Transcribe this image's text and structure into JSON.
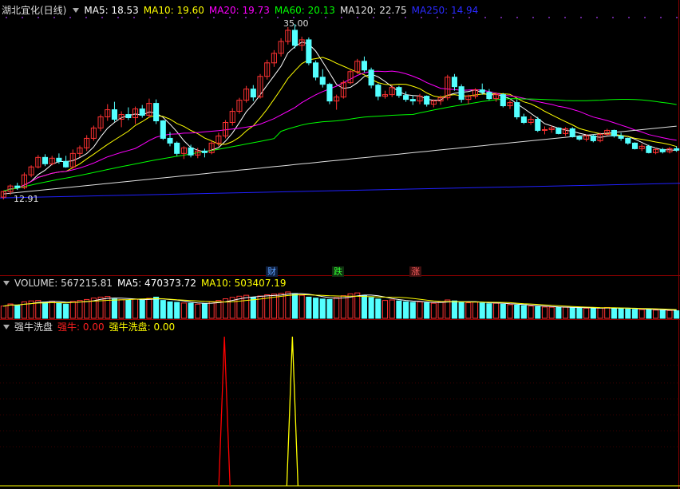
{
  "price_header": {
    "stock": "湖北宜化(日线)",
    "ma5": "MA5: 18.53",
    "ma10": "MA10: 19.60",
    "ma20": "MA20: 19.73",
    "ma60": "MA60: 20.13",
    "ma120": "MA120: 22.75",
    "ma250": "MA250: 14.94"
  },
  "volume_header": {
    "volume": "VOLUME: 567215.81",
    "ma5": "MA5: 470373.72",
    "ma10": "MA10: 503407.19"
  },
  "indicator_header": {
    "name": "强牛洗盘",
    "line1": "强牛: 0.00",
    "line2": "强牛洗盘: 0.00"
  },
  "markers": {
    "high_label": "35.00",
    "low_label": "12.91",
    "event_cai": "财",
    "event_die": "跌",
    "event_zhang": "涨"
  },
  "colors": {
    "up": "#ff3232",
    "down": "#54ffff",
    "ma5": "#ffffff",
    "ma10": "#ffff00",
    "ma20": "#ff00ff",
    "ma60": "#00ff00",
    "ma120": "#e0e0e0",
    "ma250": "#2020ff",
    "indicator1": "#ff0000",
    "indicator2": "#ffff00"
  },
  "chart_data": {
    "type": "candlestick",
    "price_range": [
      12.91,
      35.0
    ],
    "candles": [
      [
        13.2,
        14.0,
        12.91,
        13.9
      ],
      [
        13.9,
        14.8,
        13.5,
        14.6
      ],
      [
        14.6,
        15.0,
        14.1,
        14.4
      ],
      [
        14.4,
        16.3,
        14.2,
        16.0
      ],
      [
        16.0,
        17.2,
        15.7,
        17.0
      ],
      [
        17.0,
        18.5,
        16.8,
        18.2
      ],
      [
        18.2,
        18.6,
        17.1,
        17.4
      ],
      [
        17.4,
        18.4,
        17.2,
        18.1
      ],
      [
        18.1,
        18.7,
        17.4,
        17.7
      ],
      [
        17.7,
        18.4,
        16.9,
        17.0
      ],
      [
        17.0,
        19.2,
        16.8,
        18.7
      ],
      [
        18.7,
        19.7,
        18.2,
        19.4
      ],
      [
        19.4,
        21.0,
        19.0,
        20.6
      ],
      [
        20.6,
        22.2,
        20.3,
        21.9
      ],
      [
        21.9,
        23.6,
        21.5,
        23.3
      ],
      [
        23.3,
        24.9,
        22.8,
        24.2
      ],
      [
        24.2,
        25.2,
        22.7,
        23.0
      ],
      [
        23.0,
        24.0,
        22.0,
        23.6
      ],
      [
        23.6,
        24.5,
        22.9,
        23.2
      ],
      [
        23.2,
        24.6,
        22.4,
        24.3
      ],
      [
        24.3,
        24.8,
        23.2,
        23.5
      ],
      [
        23.5,
        25.6,
        23.2,
        25.0
      ],
      [
        25.0,
        25.5,
        22.4,
        22.8
      ],
      [
        22.8,
        22.9,
        20.4,
        20.6
      ],
      [
        20.6,
        21.4,
        19.6,
        20.0
      ],
      [
        20.0,
        20.2,
        18.4,
        18.7
      ],
      [
        18.7,
        19.6,
        18.0,
        19.4
      ],
      [
        19.4,
        19.8,
        18.2,
        18.5
      ],
      [
        18.5,
        19.4,
        18.1,
        19.0
      ],
      [
        19.0,
        19.3,
        18.2,
        18.8
      ],
      [
        18.8,
        20.3,
        18.6,
        20.0
      ],
      [
        20.0,
        21.3,
        19.6,
        20.9
      ],
      [
        20.9,
        22.9,
        20.6,
        22.6
      ],
      [
        22.6,
        24.4,
        22.2,
        24.0
      ],
      [
        24.0,
        25.7,
        23.7,
        25.4
      ],
      [
        25.4,
        27.2,
        25.1,
        26.8
      ],
      [
        26.8,
        27.3,
        25.3,
        25.8
      ],
      [
        25.8,
        28.7,
        25.6,
        28.4
      ],
      [
        28.4,
        30.5,
        28.0,
        30.1
      ],
      [
        30.1,
        31.7,
        29.6,
        31.3
      ],
      [
        31.3,
        33.2,
        30.9,
        32.8
      ],
      [
        32.8,
        34.6,
        32.4,
        34.2
      ],
      [
        34.2,
        35.0,
        31.9,
        32.3
      ],
      [
        32.3,
        33.4,
        31.6,
        33.0
      ],
      [
        33.0,
        33.3,
        29.8,
        30.1
      ],
      [
        30.1,
        30.4,
        27.9,
        28.3
      ],
      [
        28.3,
        29.3,
        27.0,
        27.4
      ],
      [
        27.4,
        27.6,
        24.9,
        25.3
      ],
      [
        25.3,
        26.1,
        24.2,
        25.8
      ],
      [
        25.8,
        27.9,
        25.6,
        27.6
      ],
      [
        27.6,
        29.3,
        27.4,
        29.0
      ],
      [
        29.0,
        30.6,
        28.7,
        30.3
      ],
      [
        30.3,
        30.9,
        28.9,
        29.2
      ],
      [
        29.2,
        29.5,
        26.9,
        27.3
      ],
      [
        27.3,
        27.5,
        25.4,
        25.9
      ],
      [
        25.9,
        26.6,
        25.6,
        26.1
      ],
      [
        26.1,
        27.3,
        25.8,
        27.0
      ],
      [
        27.0,
        27.2,
        25.7,
        26.0
      ],
      [
        26.0,
        26.5,
        25.2,
        25.5
      ],
      [
        25.5,
        26.0,
        24.8,
        25.3
      ],
      [
        25.3,
        26.2,
        24.9,
        25.9
      ],
      [
        25.9,
        26.0,
        24.6,
        24.9
      ],
      [
        24.9,
        25.5,
        24.5,
        25.3
      ],
      [
        25.3,
        26.0,
        24.8,
        25.7
      ],
      [
        25.7,
        28.6,
        25.4,
        28.3
      ],
      [
        28.3,
        28.7,
        26.6,
        27.1
      ],
      [
        27.1,
        27.4,
        25.1,
        25.5
      ],
      [
        25.5,
        26.1,
        24.9,
        25.9
      ],
      [
        25.9,
        26.9,
        25.6,
        26.7
      ],
      [
        26.7,
        27.5,
        26.1,
        26.4
      ],
      [
        26.4,
        26.8,
        25.4,
        25.6
      ],
      [
        25.6,
        26.4,
        25.2,
        26.1
      ],
      [
        26.1,
        26.3,
        24.5,
        24.7
      ],
      [
        24.7,
        25.4,
        24.3,
        25.1
      ],
      [
        25.1,
        25.5,
        23.0,
        23.3
      ],
      [
        23.3,
        23.7,
        22.4,
        22.6
      ],
      [
        22.6,
        23.4,
        22.3,
        23.0
      ],
      [
        23.0,
        23.3,
        21.4,
        21.6
      ],
      [
        21.6,
        22.1,
        21.1,
        21.7
      ],
      [
        21.7,
        22.2,
        21.3,
        21.9
      ],
      [
        21.9,
        22.0,
        21.1,
        21.2
      ],
      [
        21.2,
        22.0,
        20.9,
        21.8
      ],
      [
        21.8,
        22.0,
        20.7,
        20.8
      ],
      [
        20.8,
        21.0,
        20.3,
        20.5
      ],
      [
        20.5,
        21.1,
        20.2,
        20.9
      ],
      [
        20.9,
        21.1,
        20.1,
        20.3
      ],
      [
        20.3,
        21.3,
        20.1,
        21.1
      ],
      [
        21.1,
        21.8,
        20.9,
        21.6
      ],
      [
        21.6,
        21.7,
        20.7,
        20.9
      ],
      [
        20.9,
        21.3,
        20.3,
        20.6
      ],
      [
        20.6,
        20.7,
        19.8,
        20.0
      ],
      [
        20.0,
        20.1,
        19.2,
        19.3
      ],
      [
        19.3,
        19.9,
        19.0,
        19.6
      ],
      [
        19.6,
        19.8,
        18.7,
        18.8
      ],
      [
        18.8,
        19.4,
        18.6,
        19.2
      ],
      [
        19.2,
        19.4,
        18.7,
        18.9
      ],
      [
        18.9,
        19.5,
        18.7,
        19.3
      ],
      [
        19.3,
        19.6,
        18.9,
        19.1
      ]
    ],
    "ma250": {
      "start": 13.1,
      "end": 14.94
    },
    "volume": [
      520,
      610,
      560,
      700,
      740,
      760,
      690,
      730,
      650,
      600,
      720,
      760,
      800,
      860,
      900,
      930,
      820,
      790,
      770,
      810,
      780,
      850,
      900,
      760,
      700,
      680,
      650,
      640,
      600,
      620,
      700,
      760,
      830,
      890,
      940,
      980,
      900,
      950,
      1000,
      1030,
      1060,
      1120,
      1050,
      980,
      900,
      860,
      820,
      800,
      880,
      960,
      1040,
      1080,
      970,
      880,
      820,
      760,
      780,
      740,
      700,
      680,
      700,
      660,
      640,
      690,
      780,
      740,
      680,
      660,
      690,
      650,
      620,
      640,
      600,
      580,
      560,
      540,
      520,
      500,
      480,
      470,
      460,
      470,
      450,
      440,
      430,
      420,
      440,
      460,
      430,
      420,
      400,
      380,
      370,
      360,
      350,
      340,
      330,
      320
    ],
    "indicator_spikes": [
      {
        "series": "强牛",
        "position": 0.33,
        "value": 1
      },
      {
        "series": "强牛洗盘",
        "position": 0.43,
        "value": 1
      }
    ]
  }
}
